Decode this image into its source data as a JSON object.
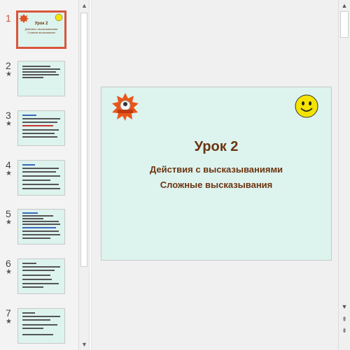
{
  "thumbnails": [
    {
      "number": "1",
      "star": "",
      "selected": true,
      "mini_title": "Урок 2",
      "mini_sub1": "Действия с высказываниями",
      "mini_sub2": "Сложные высказывания"
    },
    {
      "number": "2",
      "star": "★"
    },
    {
      "number": "3",
      "star": "★"
    },
    {
      "number": "4",
      "star": "★"
    },
    {
      "number": "5",
      "star": "★"
    },
    {
      "number": "6",
      "star": "★"
    },
    {
      "number": "7",
      "star": "★"
    }
  ],
  "slide": {
    "title": "Урок 2",
    "subtitle_line1": "Действия с высказываниями",
    "subtitle_line2": "Сложные высказывания",
    "badge_icon": "red-star-badge-icon",
    "smiley_icon": "smiley-face-icon"
  },
  "colors": {
    "slide_bg": "#ddf3ee",
    "title": "#6b3410",
    "selected_border": "#d9553c",
    "smiley": "#f5e300"
  }
}
